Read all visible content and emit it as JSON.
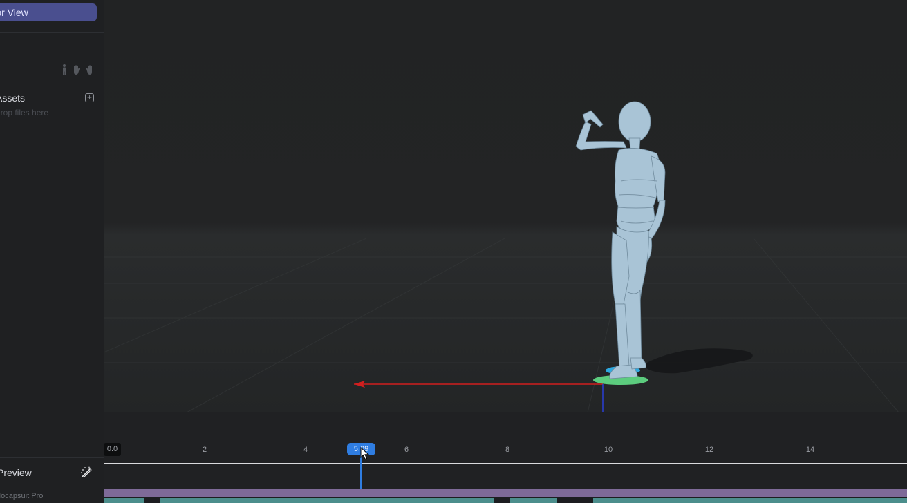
{
  "sidebar": {
    "tab_view_button": "Tab for View",
    "pose_icons": [
      "body-pose-icon",
      "left-hand-icon",
      "right-hand-icon"
    ],
    "assets_title": "Assets",
    "assets_hint": "Drop files here",
    "add_icon": "plus-square-icon",
    "preview_label": "Preview",
    "wand_icon": "magic-wand-icon",
    "brand": "Mocapsuit Pro"
  },
  "viewport": {
    "accent_color": "#3f6fd8",
    "x_axis_color": "#d11f1f",
    "z_axis_color": "#2a3fd6",
    "figure_color": "#a9c4d6",
    "foot_marker_colors": [
      "#2ea9e0",
      "#5ccc7e"
    ]
  },
  "timeline": {
    "start_time": "0.0",
    "ticks": [
      "2",
      "4",
      "6",
      "8",
      "10",
      "12",
      "14"
    ],
    "playhead": "5.09",
    "playhead_color": "#2f7de1",
    "clip_bar_color": "#7e6a98",
    "clip_color": "#4c8e8c"
  }
}
